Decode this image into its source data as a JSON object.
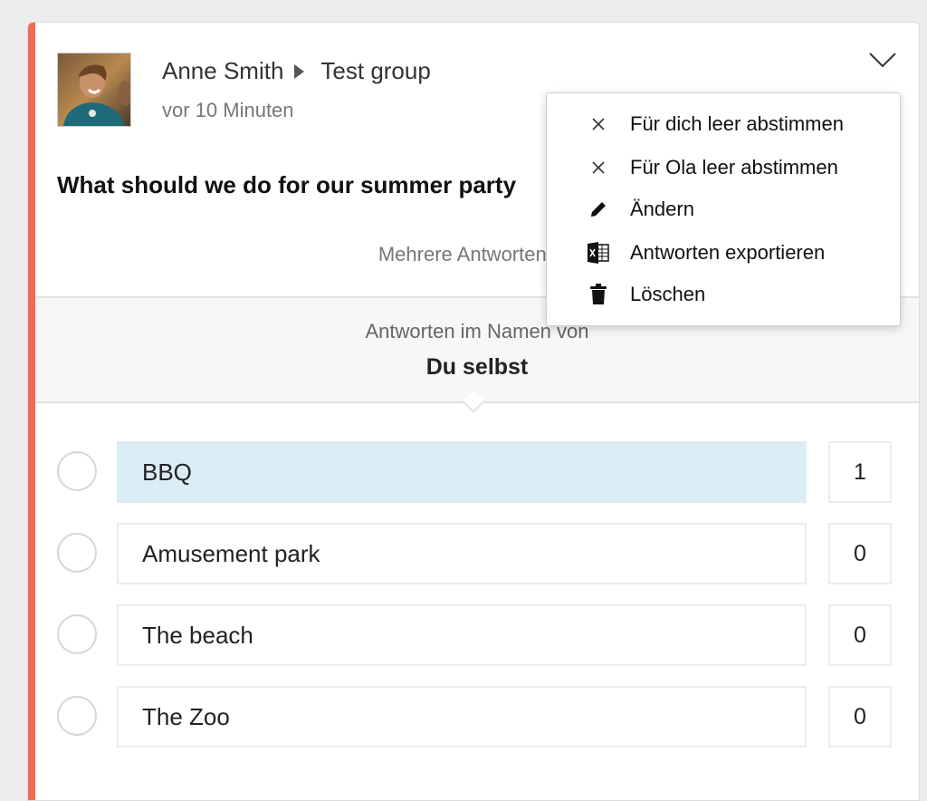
{
  "colors": {
    "accent": "#f06b54",
    "selected_option": "#dbedf4"
  },
  "post": {
    "author": "Anne Smith",
    "group": "Test group",
    "time": "vor 10 Minuten",
    "question": "What should we do for our summer party",
    "multiple_answers": "Mehrere Antworten m",
    "answer_on_behalf_label": "Antworten im Namen von",
    "answer_on_behalf_value": "Du selbst"
  },
  "options": [
    {
      "label": "BBQ",
      "count": "1",
      "selected": true
    },
    {
      "label": "Amusement park",
      "count": "0",
      "selected": false
    },
    {
      "label": "The beach",
      "count": "0",
      "selected": false
    },
    {
      "label": "The Zoo",
      "count": "0",
      "selected": false
    }
  ],
  "menu": {
    "items": [
      {
        "label": "Für dich leer abstimmen",
        "icon": "close-icon"
      },
      {
        "label": "Für Ola leer abstimmen",
        "icon": "close-icon"
      },
      {
        "label": "Ändern",
        "icon": "pencil-icon"
      },
      {
        "label": "Antworten exportieren",
        "icon": "excel-icon"
      },
      {
        "label": "Löschen",
        "icon": "trash-icon"
      }
    ]
  }
}
